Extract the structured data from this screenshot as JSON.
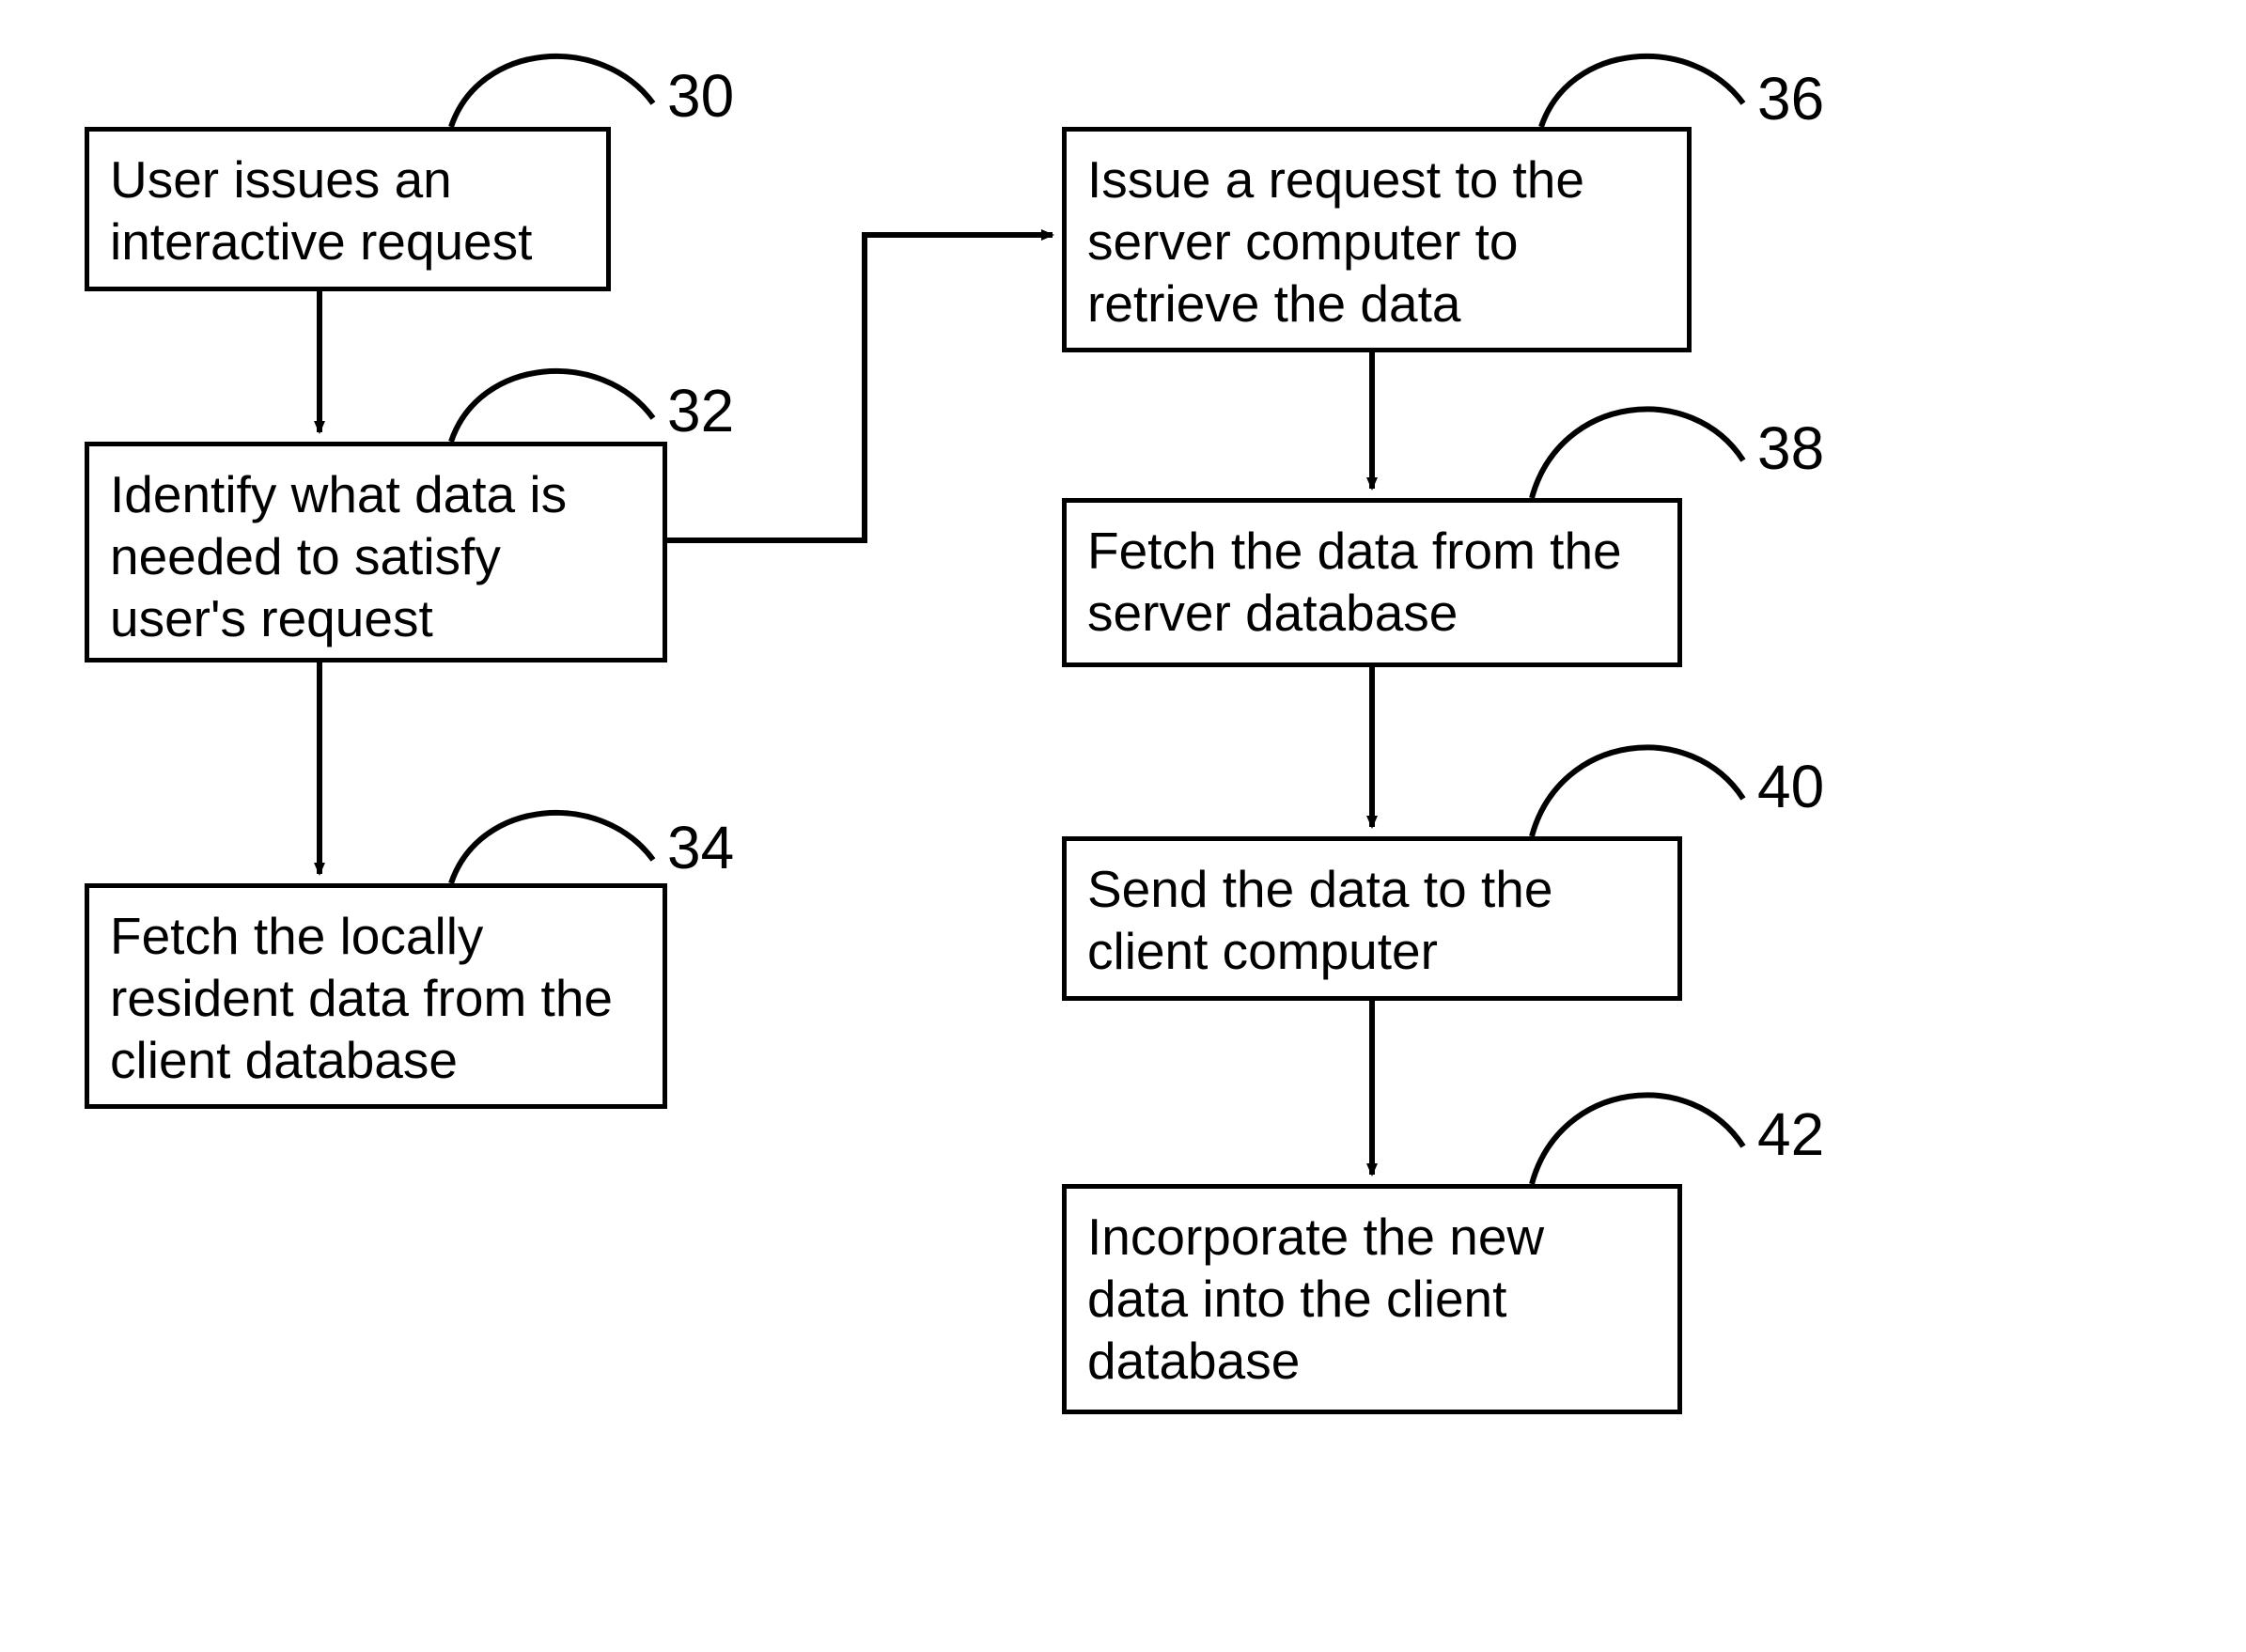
{
  "diagram": {
    "type": "flowchart",
    "nodes": {
      "n30": {
        "ref": "30",
        "text": "User issues an interactive request"
      },
      "n32": {
        "ref": "32",
        "text": "Identify what data is needed to satisfy user's request"
      },
      "n34": {
        "ref": "34",
        "text": "Fetch the locally resident data from the client database"
      },
      "n36": {
        "ref": "36",
        "text": "Issue a request to the server computer to retrieve the data"
      },
      "n38": {
        "ref": "38",
        "text": "Fetch the data from the server database"
      },
      "n40": {
        "ref": "40",
        "text": "Send the data to the client computer"
      },
      "n42": {
        "ref": "42",
        "text": "Incorporate the new data into the client database"
      }
    },
    "edges": [
      {
        "from": "n30",
        "to": "n32"
      },
      {
        "from": "n32",
        "to": "n34"
      },
      {
        "from": "n32",
        "to": "n36"
      },
      {
        "from": "n36",
        "to": "n38"
      },
      {
        "from": "n38",
        "to": "n40"
      },
      {
        "from": "n40",
        "to": "n42"
      }
    ]
  }
}
